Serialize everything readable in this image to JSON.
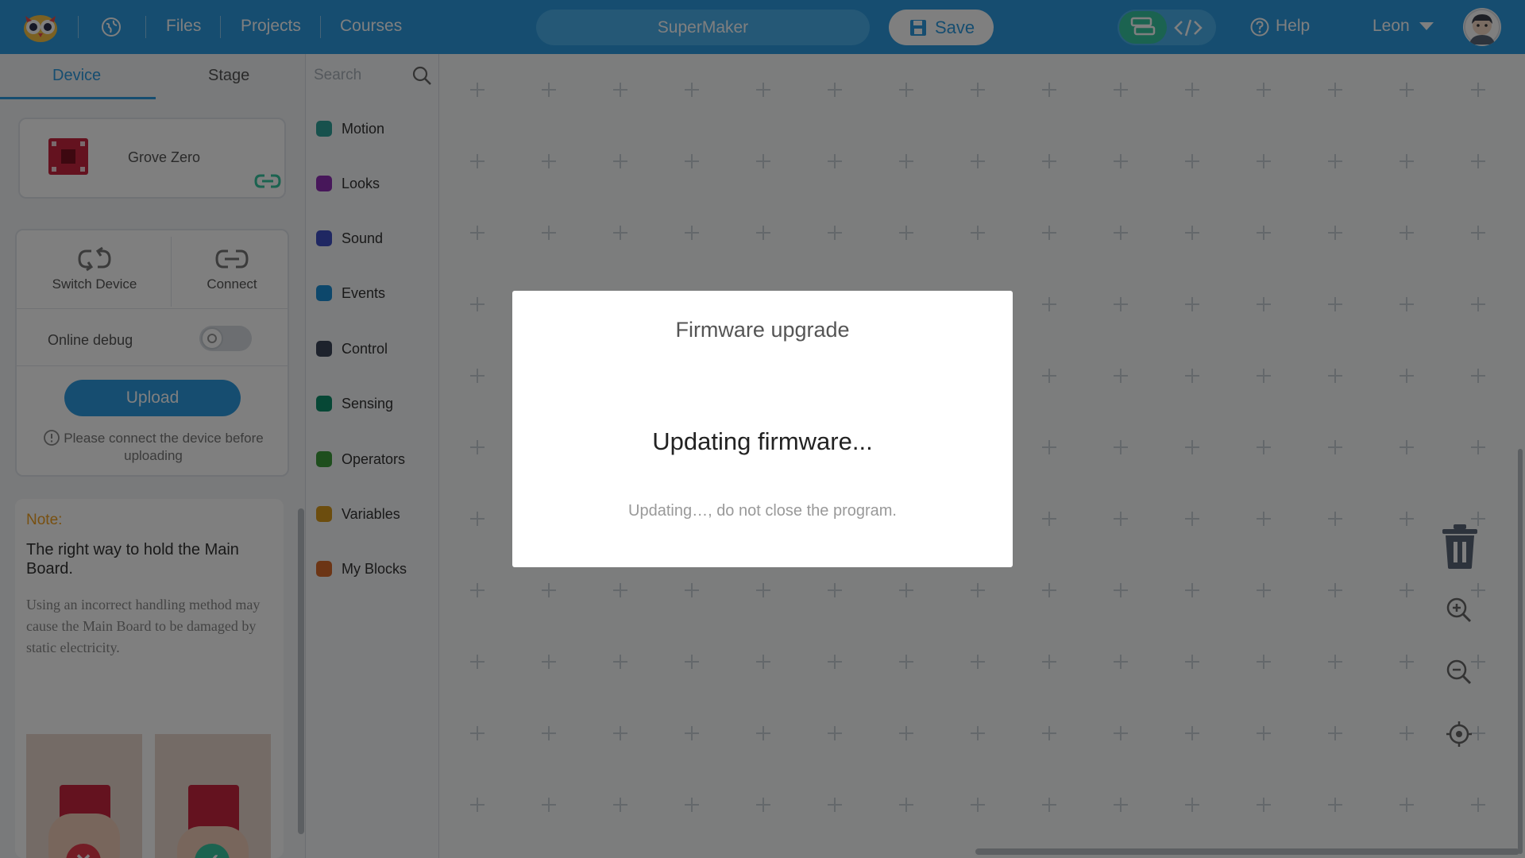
{
  "topbar": {
    "nav": [
      "Files",
      "Projects",
      "Courses"
    ],
    "project_name": "SuperMaker",
    "save_label": "Save",
    "help_label": "Help",
    "user_name": "Leon"
  },
  "left_panel": {
    "tabs": [
      "Device",
      "Stage"
    ],
    "device_name": "Grove Zero",
    "switch_device": "Switch Device",
    "connect": "Connect",
    "online_debug": "Online debug",
    "online_debug_on": false,
    "upload": "Upload",
    "upload_hint": "Please connect the device before uploading",
    "note": {
      "label": "Note:",
      "heading": "The right way to hold the Main Board.",
      "body": "Using an incorrect handling method may cause the Main Board to be damaged by static electricity."
    }
  },
  "categories": {
    "search_placeholder": "Search",
    "items": [
      {
        "label": "Motion",
        "color": "#2fa39a"
      },
      {
        "label": "Looks",
        "color": "#8e2fb5"
      },
      {
        "label": "Sound",
        "color": "#3f4fc4"
      },
      {
        "label": "Events",
        "color": "#1a8fd6"
      },
      {
        "label": "Control",
        "color": "#3a4458"
      },
      {
        "label": "Sensing",
        "color": "#0d8f6a"
      },
      {
        "label": "Operators",
        "color": "#3c9d3a"
      },
      {
        "label": "Variables",
        "color": "#d99a1c"
      },
      {
        "label": "My Blocks",
        "color": "#d96a2a"
      }
    ]
  },
  "dialog": {
    "title": "Firmware upgrade",
    "status": "Updating firmware...",
    "hint": "Updating…, do not close the program."
  },
  "colors": {
    "accent": "#2d9be0",
    "success": "#37c6a0",
    "danger": "#e63b4a",
    "note": "#f0a020"
  }
}
